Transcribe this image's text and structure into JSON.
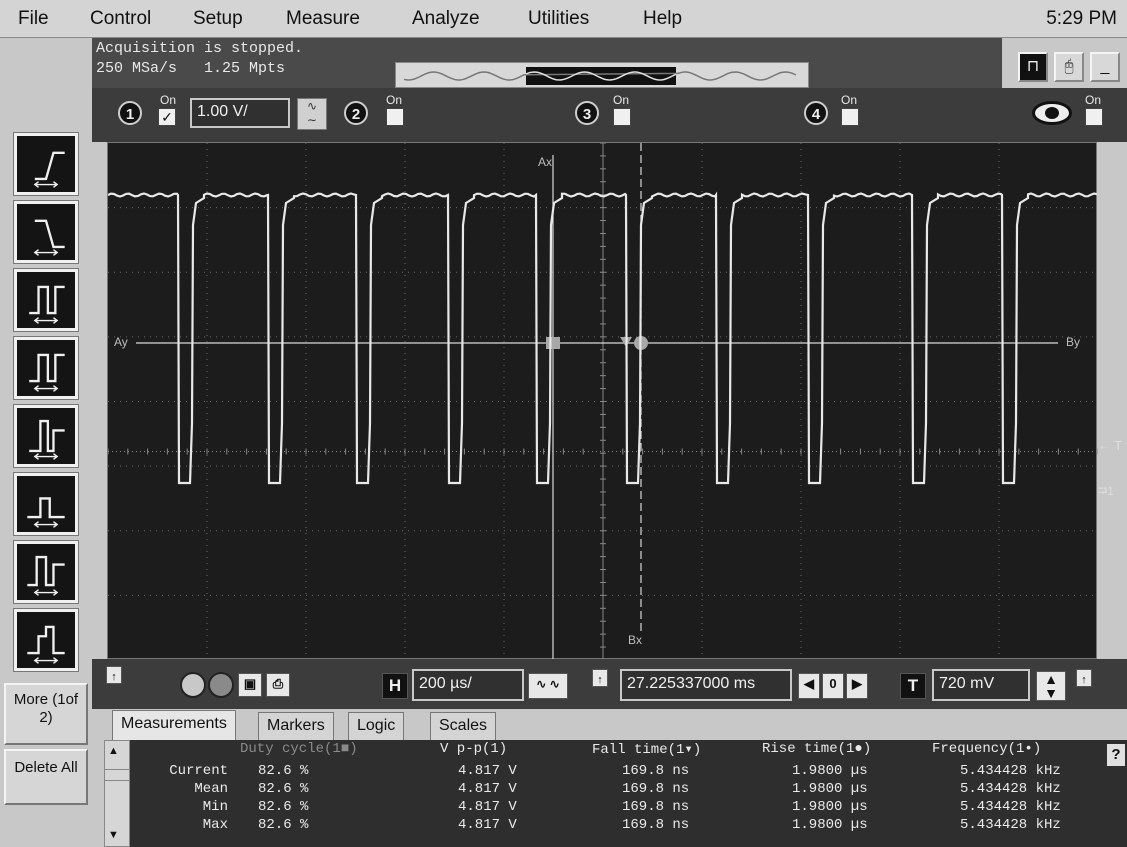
{
  "menu": {
    "items": [
      "File",
      "Control",
      "Setup",
      "Measure",
      "Analyze",
      "Utilities",
      "Help"
    ],
    "clock": "5:29 PM"
  },
  "acquisition": {
    "status": "Acquisition is stopped.",
    "sample_rate": "250 MSa/s",
    "memory_depth": "1.25 Mpts"
  },
  "channels": {
    "ch1": {
      "number": "1",
      "on_label": "On",
      "checked": "✓",
      "scale": "1.00 V/"
    },
    "ch2": {
      "number": "2",
      "on_label": "On"
    },
    "ch3": {
      "number": "3",
      "on_label": "On"
    },
    "ch4": {
      "number": "4",
      "on_label": "On"
    },
    "math": {
      "on_label": "On"
    }
  },
  "screen": {
    "marker_ax": "Ax",
    "marker_bx": "Bx",
    "marker_ay": "Ay",
    "marker_by": "By",
    "trigger_label": "← T",
    "trigger_channel": "1",
    "waveform_color": "#e8e8e8",
    "grid_color": "#6a6a6a"
  },
  "controls": {
    "horizontal_label": "H",
    "timebase": "200 µs/",
    "delay": "27.225337000 ms",
    "delay_ref": "0",
    "trigger_label": "T",
    "trigger_level": "720 mV"
  },
  "left_buttons": {
    "more": "More (1of 2)",
    "delete_all": "Delete All"
  },
  "tabs": [
    "Measurements",
    "Markers",
    "Logic",
    "Scales"
  ],
  "measurements": {
    "headers": [
      "Duty cycle(1■)",
      "V p-p(1)",
      "Fall time(1▾)",
      "Rise time(1●)",
      "Frequency(1•)"
    ],
    "rows": [
      {
        "label": "Current",
        "values": [
          "82.6 %",
          "4.817 V",
          "169.8 ns",
          "1.9800 µs",
          "5.434428 kHz"
        ]
      },
      {
        "label": "Mean",
        "values": [
          "82.6 %",
          "4.817 V",
          "169.8 ns",
          "1.9800 µs",
          "5.434428 kHz"
        ]
      },
      {
        "label": "Min",
        "values": [
          "82.6 %",
          "4.817 V",
          "169.8 ns",
          "1.9800 µs",
          "5.434428 kHz"
        ]
      },
      {
        "label": "Max",
        "values": [
          "82.6 %",
          "4.817 V",
          "169.8 ns",
          "1.9800 µs",
          "5.434428 kHz"
        ]
      }
    ],
    "help": "?"
  },
  "icons": {
    "toolbar": [
      "rising-edge-icon",
      "falling-edge-icon",
      "pulse-width-icon",
      "pulse-width-ratio-icon",
      "glitch-icon",
      "runt-icon",
      "timeout-icon",
      "pattern-icon"
    ]
  }
}
